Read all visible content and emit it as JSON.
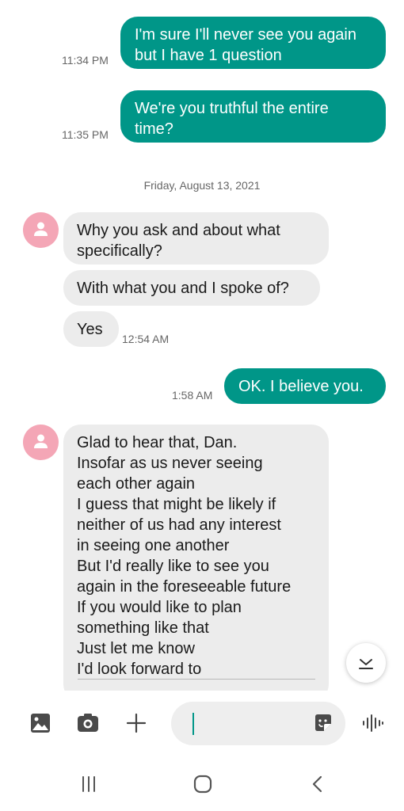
{
  "messages": {
    "out1": {
      "text": "I'm sure I'll never see you again but I have 1 question",
      "time": "11:34 PM"
    },
    "out2": {
      "text": "We're you truthful the entire time?",
      "time": "11:35 PM"
    },
    "date_separator": "Friday, August 13, 2021",
    "in1": {
      "text": "Why you ask and about what specifically?"
    },
    "in2": {
      "text": "With what you and I spoke of?"
    },
    "in3": {
      "text": "Yes",
      "time": "12:54 AM"
    },
    "out3": {
      "text": "OK. I believe you.",
      "time": "1:58 AM"
    },
    "in4": {
      "lines": [
        "Glad to hear that,  Dan.",
        "Insofar as us never seeing",
        "each other again",
        "I guess that might be likely if",
        "neither of us had any interest",
        "in seeing one another",
        "But I'd really like to see you",
        "again in the foreseeable future",
        "If you would like to plan",
        "something like that",
        "Just let me know",
        "I'd look forward to"
      ]
    }
  },
  "composer": {
    "input_value": "",
    "icons": [
      "gallery-icon",
      "camera-icon",
      "plus-icon",
      "sticker-icon",
      "voice-icon"
    ]
  },
  "colors": {
    "outgoing_bubble": "#009688",
    "incoming_bubble": "#ececec",
    "avatar": "#f4a6b6"
  }
}
